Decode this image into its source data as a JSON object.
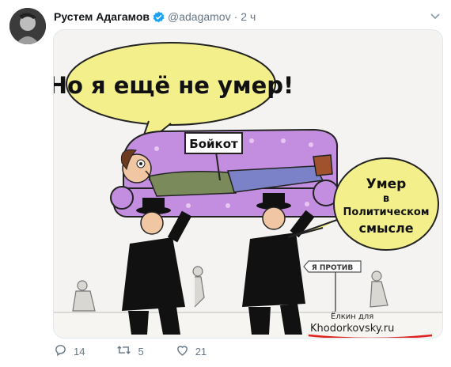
{
  "author": {
    "name": "Рустем Адагамов",
    "handle": "@adagamov",
    "separator": "·",
    "time": "2 ч"
  },
  "cartoon": {
    "speech_left": "Но я ещё не умер!",
    "sign": "Бойкот",
    "speech_right_1": "Умер",
    "speech_right_2": "в",
    "speech_right_3": "Политическом",
    "speech_right_4": "смысле",
    "arrow_sign": "Я ПРОТИВ",
    "signature": "Ёлкин для",
    "site": "Khodorkovsky.ru"
  },
  "actions": {
    "replies": "14",
    "retweets": "5",
    "likes": "21"
  },
  "colors": {
    "sofa": "#c48ee0",
    "bubble": "#f2f08a",
    "accent": "#1da1f2"
  },
  "icons": [
    "verified-icon",
    "chevron-down-icon",
    "reply-icon",
    "retweet-icon",
    "like-icon"
  ]
}
